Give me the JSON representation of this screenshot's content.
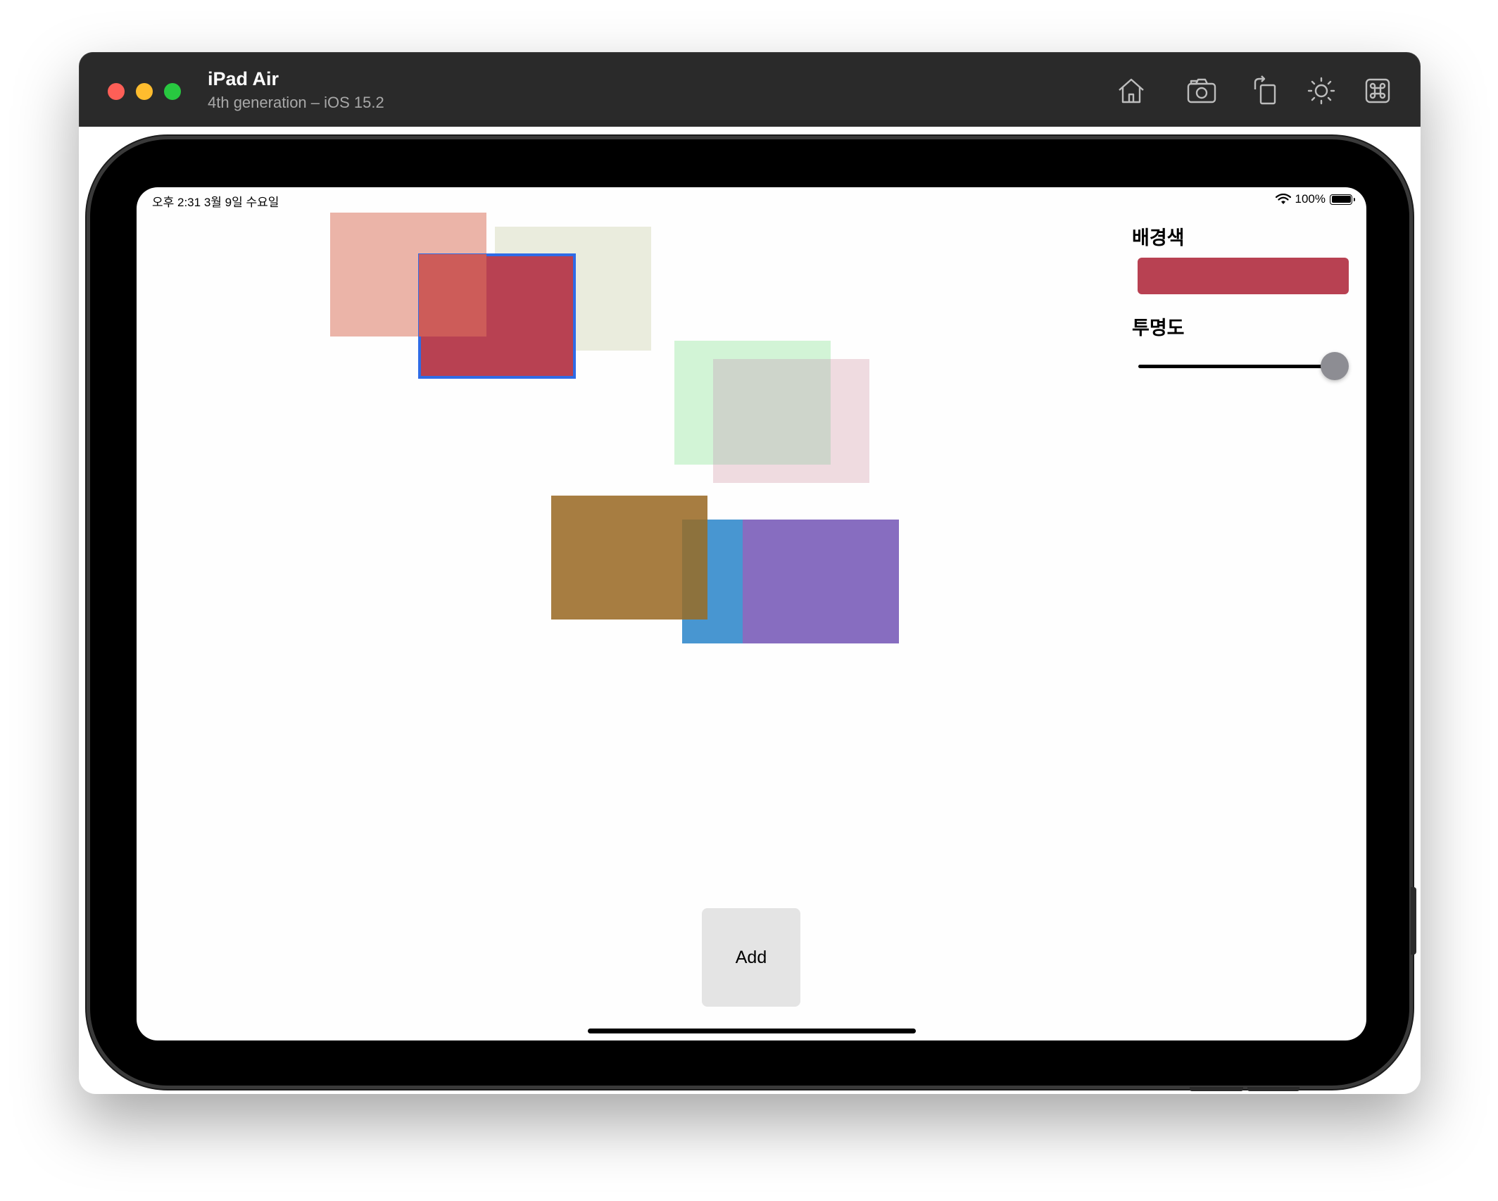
{
  "window": {
    "title": "iPad Air",
    "subtitle": "4th generation – iOS 15.2",
    "toolbar_icons": [
      "home-icon",
      "camera-icon",
      "rotate-icon",
      "brightness-icon",
      "keyboard-command-icon"
    ]
  },
  "status_bar": {
    "time_date": "오후 2:31   3월 9일 수요일",
    "battery": "100%"
  },
  "inspector": {
    "background_label": "배경색",
    "background_color": "#b84152",
    "opacity_label": "투명도",
    "opacity_value": 1.0
  },
  "canvas": {
    "squares": [
      {
        "color": "#ebb4a8"
      },
      {
        "color": "#eaecdd"
      },
      {
        "color": "#cd5c59"
      },
      {
        "color": "#b84152",
        "selected": true
      },
      {
        "color": "#d2f4d6"
      },
      {
        "color": "#efdbe0"
      },
      {
        "color": "#ced5cb"
      },
      {
        "color": "#4896d1"
      },
      {
        "color": "#876dc0"
      },
      {
        "color": "#a77d41"
      },
      {
        "color": "#8d723d"
      }
    ]
  },
  "add_button": {
    "label": "Add"
  }
}
